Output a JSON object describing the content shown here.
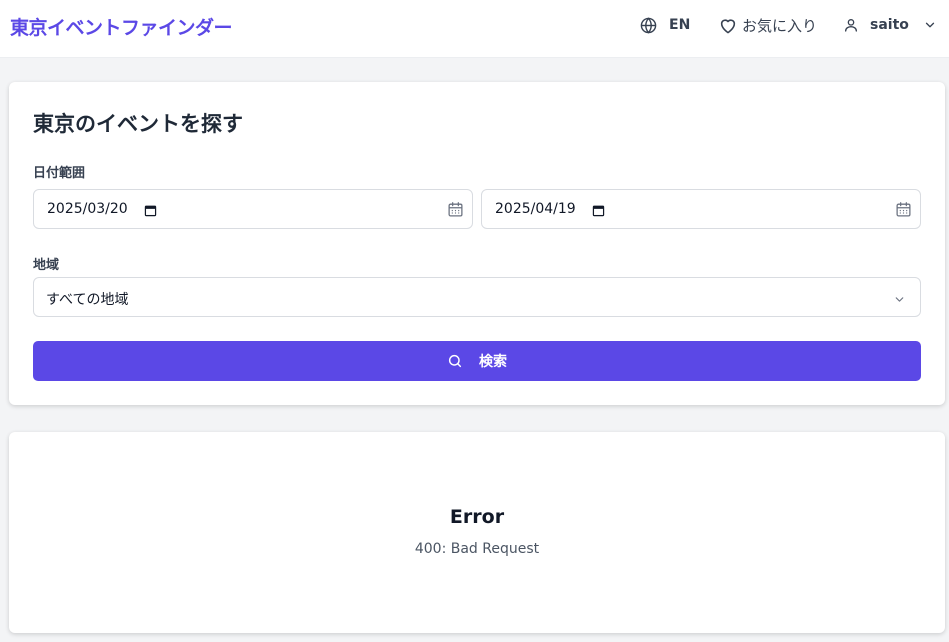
{
  "header": {
    "brand": "東京イベントファインダー",
    "language_label": "EN",
    "favorites_label": "お気に入り",
    "username": "saito"
  },
  "search": {
    "title": "東京のイベントを探す",
    "date_range_label": "日付範囲",
    "start_date": "2025/03/20",
    "end_date": "2025/04/19",
    "region_label": "地域",
    "region_selected": "すべての地域",
    "search_button_label": "検索"
  },
  "error": {
    "title": "Error",
    "message": "400: Bad Request"
  },
  "colors": {
    "accent": "#5b48e6",
    "background": "#f3f4f6",
    "card": "#ffffff"
  }
}
